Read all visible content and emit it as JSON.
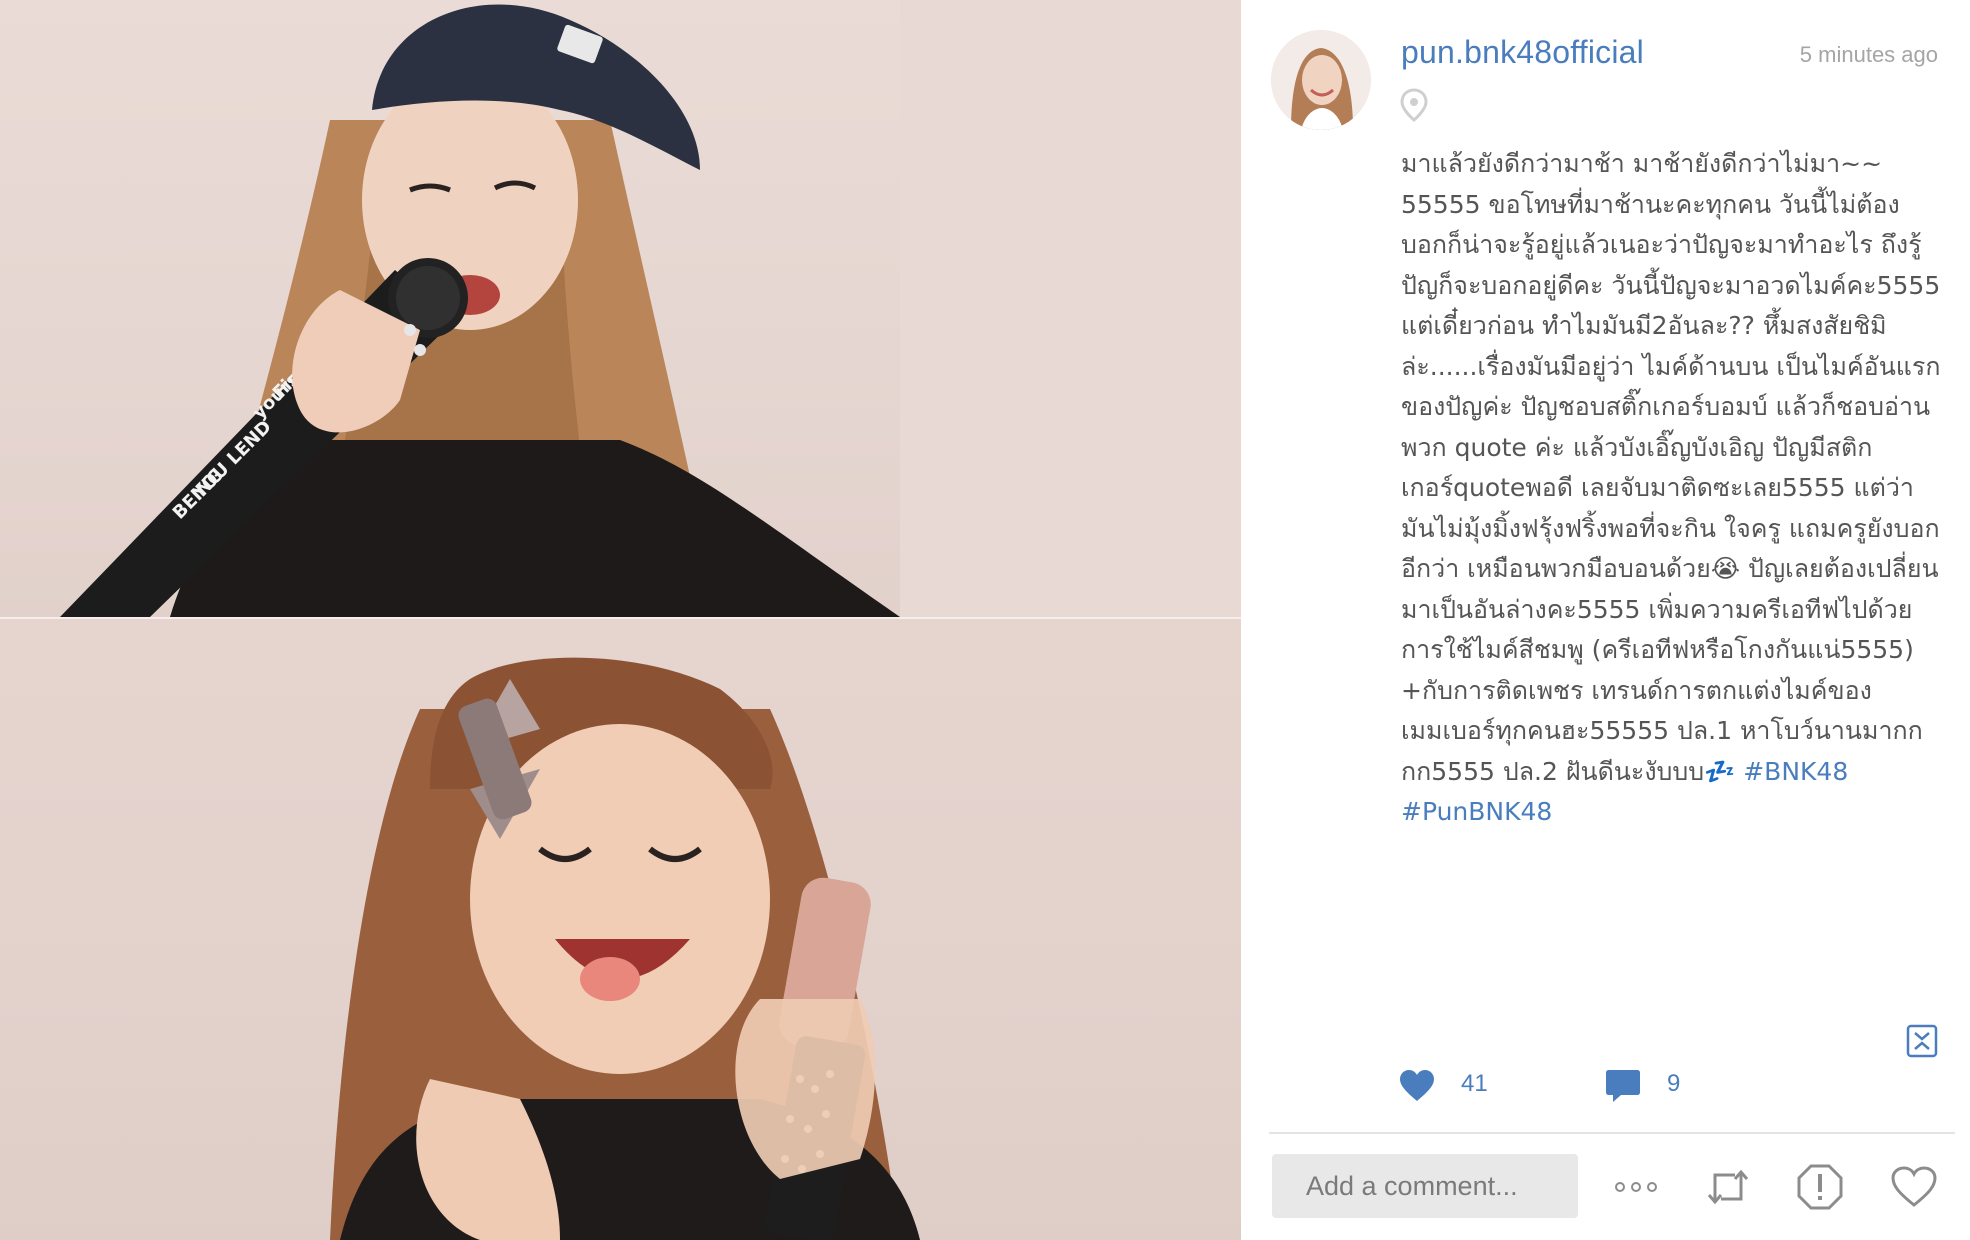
{
  "post": {
    "username": "pun.bnk48official",
    "timestamp": "5 minutes ago",
    "caption": "มาแล้วยังดีกว่ามาช้า มาช้ายังดีกว่าไม่มา~~ 55555 ขอโทษที่มาช้านะคะทุกคน วันนี้ไม่ต้องบอกก็น่าจะรู้อยู่แล้วเนอะว่าปัญจะมาทำอะไร ถึงรู้ปัญก็จะบอกอยู่ดีคะ วันนี้ปัญจะมาอวดไมค์คะ5555 แต่เดี๋ยวก่อน ทำไมมันมี2อันละ?? หึ้มสงสัยชิมิล่ะ......เรื่องมันมีอยู่ว่า ไมค์ด้านบน เป็นไมค์อันแรกของปัญค่ะ ปัญชอบสติ๊กเกอร์บอมบ์ แล้วก็ชอบอ่านพวก quote ค่ะ แล้วบังเอิ๊ญบังเอิญ ปัญมีสติกเกอร์quoteพอดี เลยจับมาติดซะเลย5555 แต่ว่ามันไม่มุ้งมิ้งฟรุ้งฟริ้งพอที่จะกิน ใจครู แถมครูยังบอกอีกว่า เหมือนพวกมือบอนด้วย😭 ปัญเลยต้องเปลี่ยนมาเป็นอันล่างคะ5555 เพิ่มความครีเอทีฟไปด้วยการใช้ไมค์สีชมพู (ครีเอทีฟหรือโกงกันแน่5555) +กับการติดเพชร เทรนด์การตกแต่งไมค์ของเมมเบอร์ทุกคนฮะ55555 ปล.1 หาโบว์นานมากกกก5555 ปล.2 ฝันดีนะงับบบ💤",
    "hashtags": "#BNK48 #PunBNK48",
    "likes": "41",
    "comments": "9"
  },
  "comment_input": {
    "placeholder": "Add a comment..."
  },
  "icons": {
    "location": "location-pin-icon",
    "expand": "expand-icon",
    "like": "heart-filled-icon",
    "comment": "speech-bubble-icon",
    "more": "more-dots-icon",
    "repost": "repost-icon",
    "report": "report-icon",
    "favorite": "heart-outline-icon"
  },
  "colors": {
    "accent": "#4a7dbd",
    "muted_text": "#a5a5a5",
    "caption_text": "#555555",
    "comment_bg": "#e8e8e8"
  }
}
